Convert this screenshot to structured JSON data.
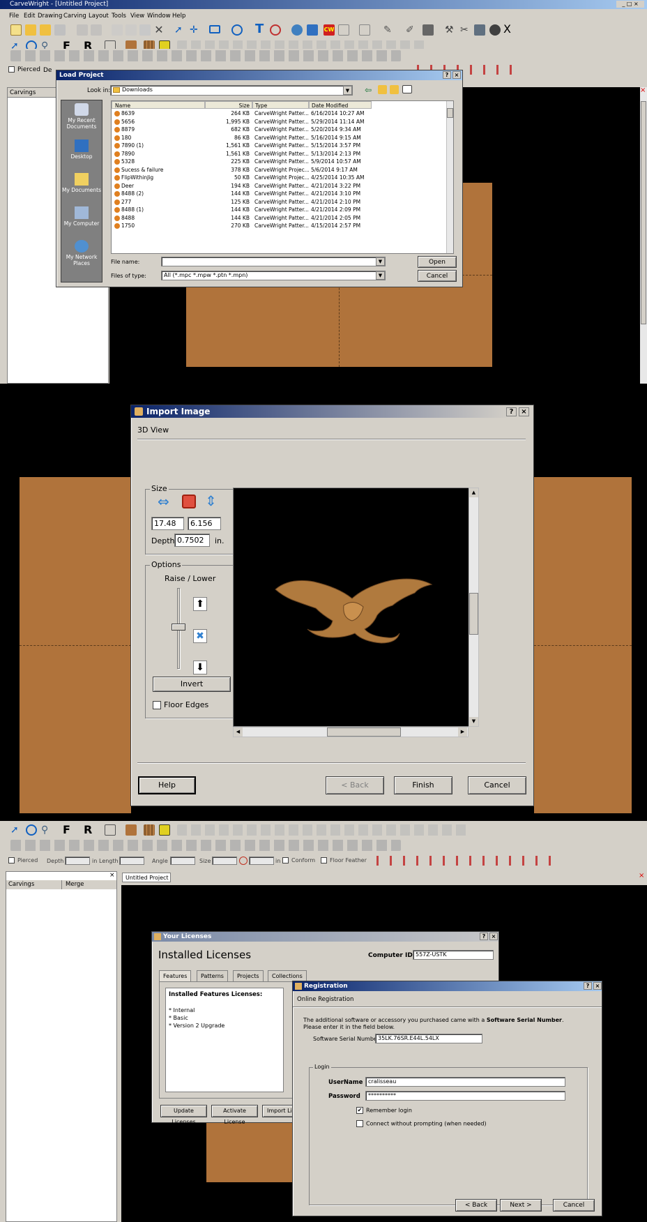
{
  "top": {
    "app_title": "CarveWright - [Untitled Project]",
    "menu": [
      "File",
      "Edit",
      "Drawing",
      "Carving",
      "Layout",
      "Tools",
      "View",
      "Window",
      "Help"
    ],
    "left_panel_header": "Carvings",
    "props": {
      "pierced": "Pierced",
      "depth": "De"
    },
    "load_project": {
      "title": "Load Project",
      "look_in_label": "Look in:",
      "look_in_value": "Downloads",
      "places": [
        "My Recent Documents",
        "Desktop",
        "My Documents",
        "My Computer",
        "My Network Places"
      ],
      "columns": [
        "Name",
        "Size",
        "Type",
        "Date Modified"
      ],
      "files": [
        {
          "name": "8639",
          "size": "264 KB",
          "type": "CarveWright Patter...",
          "date": "6/16/2014 10:27 AM"
        },
        {
          "name": "5656",
          "size": "1,995 KB",
          "type": "CarveWright Patter...",
          "date": "5/29/2014 11:14 AM"
        },
        {
          "name": "8879",
          "size": "682 KB",
          "type": "CarveWright Patter...",
          "date": "5/20/2014 9:34 AM"
        },
        {
          "name": "180",
          "size": "86 KB",
          "type": "CarveWright Patter...",
          "date": "5/16/2014 9:15 AM"
        },
        {
          "name": "7890 (1)",
          "size": "1,561 KB",
          "type": "CarveWright Patter...",
          "date": "5/15/2014 3:57 PM"
        },
        {
          "name": "7890",
          "size": "1,561 KB",
          "type": "CarveWright Patter...",
          "date": "5/13/2014 2:13 PM"
        },
        {
          "name": "5328",
          "size": "225 KB",
          "type": "CarveWright Patter...",
          "date": "5/9/2014 10:57 AM"
        },
        {
          "name": "Sucess & failure",
          "size": "378 KB",
          "type": "CarveWright Projec...",
          "date": "5/6/2014 9:17 AM"
        },
        {
          "name": "FlipWithinJig",
          "size": "50 KB",
          "type": "CarveWright Projec...",
          "date": "4/25/2014 10:35 AM"
        },
        {
          "name": "Deer",
          "size": "194 KB",
          "type": "CarveWright Patter...",
          "date": "4/21/2014 3:22 PM"
        },
        {
          "name": "8488 (2)",
          "size": "144 KB",
          "type": "CarveWright Patter...",
          "date": "4/21/2014 3:10 PM"
        },
        {
          "name": "277",
          "size": "125 KB",
          "type": "CarveWright Patter...",
          "date": "4/21/2014 2:10 PM"
        },
        {
          "name": "8488 (1)",
          "size": "144 KB",
          "type": "CarveWright Patter...",
          "date": "4/21/2014 2:09 PM"
        },
        {
          "name": "8488",
          "size": "144 KB",
          "type": "CarveWright Patter...",
          "date": "4/21/2014 2:05 PM"
        },
        {
          "name": "1750",
          "size": "270 KB",
          "type": "CarveWright Patter...",
          "date": "4/15/2014 2:57 PM"
        }
      ],
      "file_name_label": "File name:",
      "file_name_value": "",
      "files_of_type_label": "Files of type:",
      "files_of_type_value": "All (*.mpc *.mpw *.ptn *.mpn)",
      "open": "Open",
      "cancel": "Cancel"
    }
  },
  "middle": {
    "title": "Import Image",
    "subtitle": "3D View",
    "size_group": "Size",
    "width": "17.48",
    "height": "6.156",
    "depth_label": "Depth",
    "depth": "0.7502",
    "unit": "in.",
    "options_group": "Options",
    "raise_lower": "Raise / Lower",
    "invert": "Invert",
    "floor_edges": "Floor Edges",
    "help": "Help",
    "back": "< Back",
    "finish": "Finish",
    "cancel": "Cancel"
  },
  "bottom": {
    "props": {
      "pierced": "Pierced",
      "depth": "Depth",
      "length": "Length",
      "angle": "Angle",
      "size": "Size",
      "unit": "in",
      "conform": "Conform",
      "floor_feather": "Floor Feather"
    },
    "left_columns": [
      "Carvings",
      "Merge"
    ],
    "doc_tab": "Untitled Project",
    "licenses": {
      "title": "Your Licenses",
      "heading": "Installed Licenses",
      "computer_id_label": "Computer ID:",
      "computer_id": "557Z-USTK",
      "tabs": [
        "Features",
        "Patterns",
        "Projects",
        "Collections"
      ],
      "list_heading": "Installed Features Licenses:",
      "items": [
        "* Internal",
        "* Basic",
        "* Version 2 Upgrade"
      ],
      "buttons": [
        "Update Licenses",
        "Activate License",
        "Import Lice"
      ]
    },
    "registration": {
      "title": "Registration",
      "subtitle": "Online Registration",
      "text1": "The additional software or accessory you purchased came with a ",
      "text1_bold": "Software Serial Number",
      "text1_end": ".",
      "text2": "Please enter it in the field below.",
      "serial_label": "Software Serial Number",
      "serial": "35LK.76SR.E44L.54LX",
      "login_group": "Login",
      "username_label": "UserName",
      "username": "cralisseau",
      "password_label": "Password",
      "password": "**********",
      "remember": "Remember login",
      "remember_checked": "✔",
      "connect": "Connect without prompting (when needed)",
      "back": "< Back",
      "next": "Next >",
      "cancel": "Cancel"
    }
  },
  "colors": {
    "wood": "#b0733b",
    "dialog": "#d4d0c8",
    "title_start": "#0a246a",
    "title_end": "#a6caf0",
    "canvas": "#000000"
  }
}
